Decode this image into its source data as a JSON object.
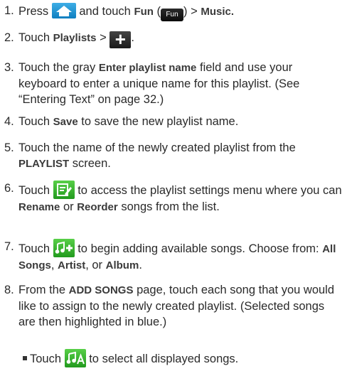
{
  "steps": [
    {
      "n": "1.",
      "parts": {
        "a": "Press",
        "b": "and touch",
        "fun": "Fun",
        "c": "(",
        "fun_icon": "Fun",
        "d": ") >",
        "music": "Music."
      }
    },
    {
      "n": "2.",
      "parts": {
        "a": "Touch",
        "playlists": "Playlists",
        "gt": ">",
        "end": "."
      }
    },
    {
      "n": "3.",
      "parts": {
        "a": "Touch the gray",
        "field": "Enter playlist name",
        "b": "field and use your keyboard to enter a unique name for this playlist. (See “Entering Text” on page 32.)"
      }
    },
    {
      "n": "4.",
      "parts": {
        "a": "Touch",
        "save": "Save",
        "b": "to save the new playlist name."
      }
    },
    {
      "n": "5.",
      "parts": {
        "a": "Touch the name of the newly created playlist from the",
        "screen": "PLAYLIST",
        "b": "screen."
      }
    },
    {
      "n": "6.",
      "parts": {
        "a": "Touch",
        "b": "to access the playlist settings menu where you can",
        "rename": "Rename",
        "or": "or",
        "reorder": "Reorder",
        "c": "songs from the list."
      }
    },
    {
      "n": "7.",
      "parts": {
        "a": "Touch",
        "b": "to begin adding available songs. Choose from:",
        "all": "All Songs",
        ",1": ",",
        "artist": "Artist",
        ",2": ", or",
        "album": "Album",
        "end": "."
      }
    },
    {
      "n": "8.",
      "parts": {
        "a": "From the",
        "page": "ADD SONGS",
        "b": "page, touch each song that you would like to assign to the newly created playlist. (Selected songs are then highlighted in blue.)"
      }
    }
  ],
  "bullet": {
    "a": "Touch",
    "b": "to select all displayed songs."
  },
  "icons": [
    "home-icon",
    "fun-icon",
    "plus-icon",
    "edit-list-icon",
    "add-music-icon",
    "select-all-music-icon"
  ]
}
